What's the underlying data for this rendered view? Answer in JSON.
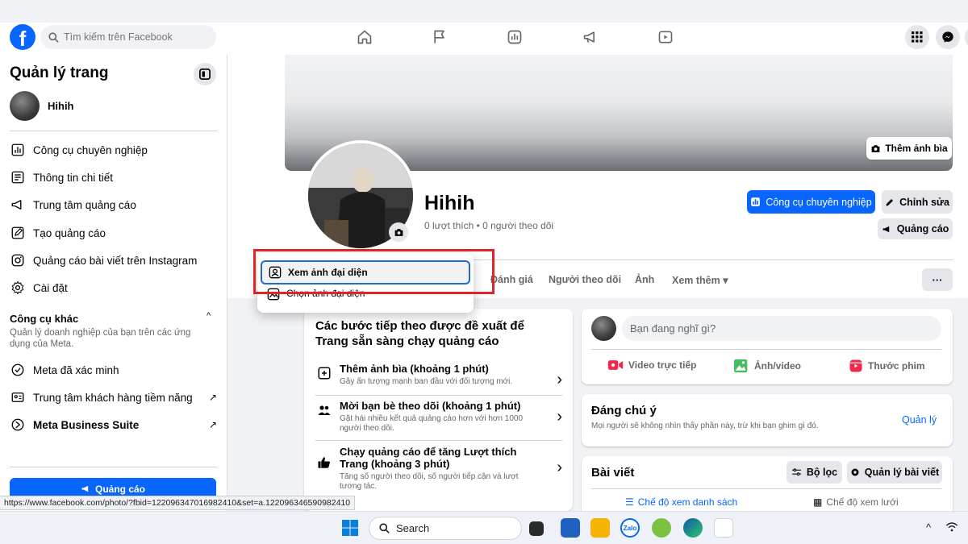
{
  "navbar": {
    "logo": "f",
    "search_placeholder": "Tìm kiếm trên Facebook",
    "nav_icons": [
      "home-icon",
      "flag-icon",
      "insights-icon",
      "megaphone-icon",
      "video-icon"
    ],
    "right_icons": [
      "menu-grid-icon",
      "messenger-icon"
    ]
  },
  "sidebar": {
    "title": "Quản lý trang",
    "page_name": "Hihih",
    "items": [
      {
        "label": "Công cụ chuyên nghiệp",
        "icon": "chart-icon"
      },
      {
        "label": "Thông tin chi tiết",
        "icon": "details-icon"
      },
      {
        "label": "Trung tâm quảng cáo",
        "icon": "megaphone-icon"
      },
      {
        "label": "Tạo quảng cáo",
        "icon": "pencil-icon"
      },
      {
        "label": "Quảng cáo bài viết trên Instagram",
        "icon": "instagram-icon"
      },
      {
        "label": "Cài đặt",
        "icon": "gear-icon"
      }
    ],
    "other_tools_title": "Công cụ khác",
    "other_tools_desc": "Quản lý doanh nghiệp của bạn trên các ứng dụng của Meta.",
    "tools": [
      {
        "label": "Meta đã xác minh",
        "icon": "verified-icon"
      },
      {
        "label": "Trung tâm khách hàng tiềm năng",
        "icon": "leads-icon"
      },
      {
        "label": "Meta Business Suite",
        "icon": "meta-icon"
      }
    ],
    "ad_button": "Quảng cáo"
  },
  "status_url": "https://www.facebook.com/photo/?fbid=122096347016982410&set=a.122096346590982410",
  "profile": {
    "add_cover": "Thêm ảnh bìa",
    "name": "Hihih",
    "stats": "0 lượt thích • 0 người theo dõi",
    "pro_tools": "Công cụ chuyên nghiệp",
    "edit": "Chỉnh sửa",
    "advertise": "Quảng cáo",
    "tabs": [
      "Đánh giá",
      "Người theo dõi",
      "Ảnh",
      "Xem thêm ▾"
    ],
    "more": "···"
  },
  "popup": {
    "items": [
      "Xem ảnh đại diện",
      "Chọn ảnh đại diện"
    ]
  },
  "steps_card": {
    "title": "Các bước tiếp theo được đề xuất để Trang sẵn sàng chạy quảng cáo",
    "steps": [
      {
        "title": "Thêm ảnh bìa (khoảng 1 phút)",
        "desc": "Gây ấn tượng mạnh ban đầu với đối tượng mới."
      },
      {
        "title": "Mời bạn bè theo dõi (khoảng 1 phút)",
        "desc": "Gặt hái nhiều kết quả quảng cáo hơn với hơn 1000 người theo dõi."
      },
      {
        "title": "Chạy quảng cáo để tăng Lượt thích Trang (khoảng 3 phút)",
        "desc": "Tăng số người theo dõi, số người tiếp cận và lượt tương tác."
      }
    ]
  },
  "post_card": {
    "placeholder": "Bạn đang nghĩ gì?",
    "actions": [
      "Video trực tiếp",
      "Ảnh/video",
      "Thước phim"
    ]
  },
  "featured_card": {
    "title": "Đáng chú ý",
    "desc": "Mọi người sẽ không nhìn thấy phần này, trừ khi bạn ghim gì đó.",
    "manage": "Quản lý"
  },
  "posts_card": {
    "title": "Bài viết",
    "filter": "Bộ lọc",
    "manage_posts": "Quản lý bài viết",
    "list_view": "Chế độ xem danh sách",
    "grid_view": "Chế độ xem lưới"
  },
  "taskbar": {
    "search": "Search",
    "zalo": "Zalo"
  },
  "colors": {
    "brand": "#0866ff",
    "highlight": "#e0242a"
  }
}
